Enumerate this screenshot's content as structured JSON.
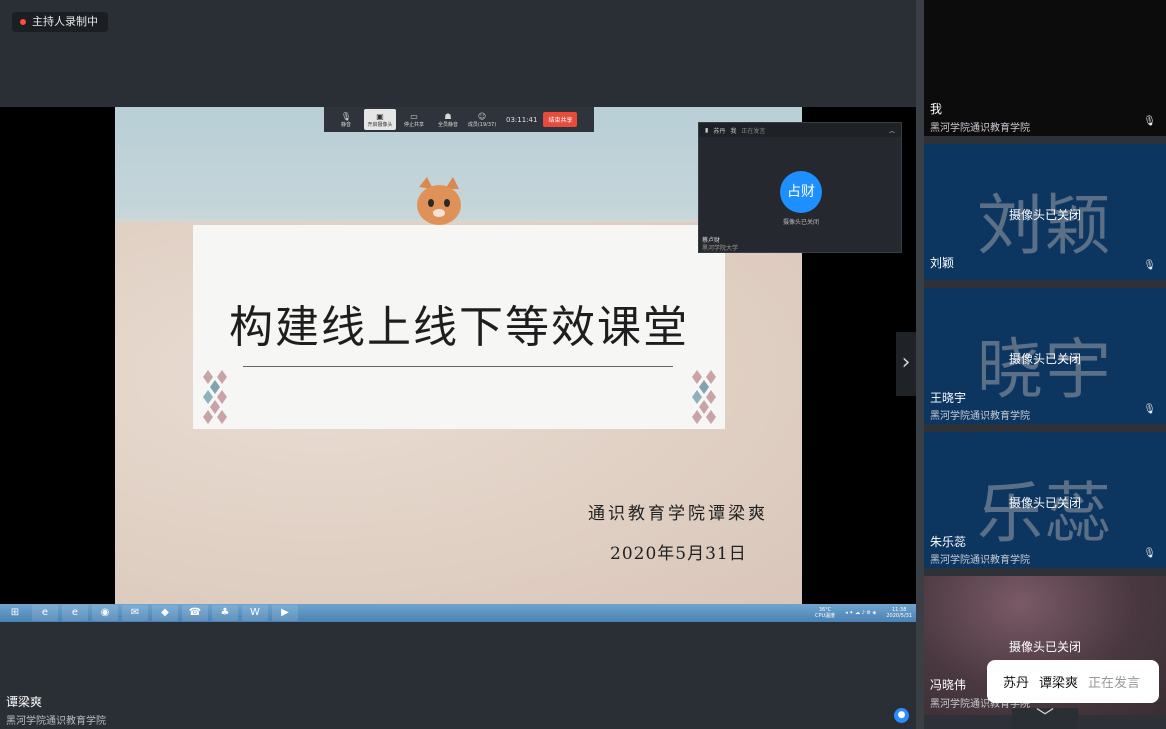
{
  "recording": {
    "label": "主持人录制中"
  },
  "toolbar": {
    "items": [
      {
        "icon": "mic-icon",
        "label": "静音"
      },
      {
        "icon": "camera-icon",
        "label": "开启摄像头"
      },
      {
        "icon": "share-icon",
        "label": "停止共享"
      },
      {
        "icon": "mute-all-icon",
        "label": "全员静音"
      },
      {
        "icon": "members-icon",
        "label": "成员(19/37)"
      }
    ],
    "timer": "03:11:41",
    "end_label": "结束共享"
  },
  "slide": {
    "title": "构建线上线下等效课堂",
    "author": "通识教育学院谭梁爽",
    "date": "2020年5月31日"
  },
  "mini_window": {
    "speaker": "苏丹",
    "me_label": "我",
    "status": "正在发言",
    "avatar_text": "占财",
    "camera_status": "摄像头已关闭",
    "name": "蔡卢财",
    "org": "黑河学院大学"
  },
  "taskbar": {
    "weather": "36°C",
    "cpu_label": "CPU温度",
    "time": "11:38",
    "date": "2020/5/31"
  },
  "presenter": {
    "name": "谭梁爽",
    "org": "黑河学院通识教育学院"
  },
  "participants": [
    {
      "name": "我",
      "org": "黑河学院通识教育学院",
      "big": "",
      "camera": ""
    },
    {
      "name": "刘颖",
      "org": "",
      "big": "刘颖",
      "camera": "摄像头已关闭"
    },
    {
      "name": "王晓宇",
      "org": "黑河学院通识教育学院",
      "big": "晓宇",
      "camera": "摄像头已关闭"
    },
    {
      "name": "朱乐蕊",
      "org": "黑河学院通识教育学院",
      "big": "乐蕊",
      "camera": "摄像头已关闭"
    },
    {
      "name": "冯晓伟",
      "org": "黑河学院通识教育学院",
      "big": "",
      "camera": "摄像头已关闭"
    }
  ],
  "speaking_bubble": {
    "speakers": [
      "苏丹",
      "谭梁爽"
    ],
    "status": "正在发言"
  },
  "colors": {
    "accent": "#1e8fff",
    "end_button": "#e64b3b",
    "tile_blue": "#0c3560",
    "recording_dot": "#ff4d3a"
  }
}
